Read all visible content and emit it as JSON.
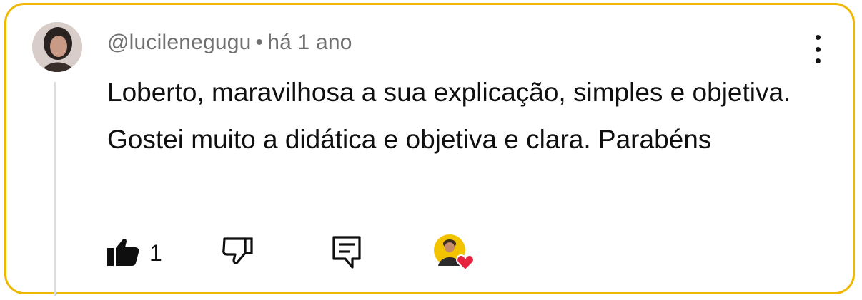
{
  "comment": {
    "author": "@lucilenegugu",
    "separator": "•",
    "time": "há 1 ano",
    "text": "Loberto, maravilhosa a sua explicação, simples e objetiva. Gostei muito a didática e objetiva e clara. Parabéns"
  },
  "actions": {
    "like_count": "1"
  },
  "colors": {
    "border": "#f0b700",
    "meta_text": "#707070",
    "heart": "#e8233f"
  },
  "icons": [
    "kebab-menu-icon",
    "thumbs-up-icon",
    "thumbs-down-icon",
    "reply-icon",
    "creator-heart-icon"
  ]
}
